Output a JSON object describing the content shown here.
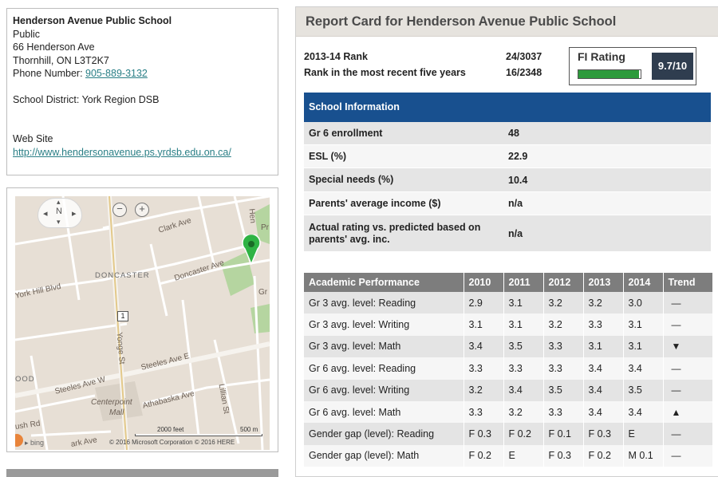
{
  "school": {
    "name": "Henderson Avenue Public School",
    "type": "Public",
    "street": "66 Henderson Ave",
    "city": "Thornhill, ON L3T2K7",
    "phone_label": "Phone Number: ",
    "phone": "905-889-3132",
    "district": "School District: York Region DSB",
    "website_label": "Web Site",
    "website": "http://www.hendersonavenue.ps.yrdsb.edu.on.ca/"
  },
  "map": {
    "compass_n": "N",
    "zoom_out": "−",
    "zoom_in": "+",
    "labels": {
      "clark": "Clark Ave",
      "doncaster_town": "DONCASTER",
      "doncaster_ave": "Doncaster Ave",
      "york_hill": "York Hill Blvd",
      "yonge": "Yonge St",
      "steeles_e": "Steeles Ave E",
      "steeles_w": "Steeles Ave W",
      "centerpoint": "Centerpoint",
      "mall": "Mall",
      "athabaska": "Athabaska Ave",
      "lillian": "Lillian St",
      "ood": "OOD",
      "ush_rd": "ush Rd",
      "ark_ave": "ark Ave",
      "gr": "Gr",
      "pr": "Pr",
      "hend": "Hen",
      "route": "1"
    },
    "scale_feet": "2000 feet",
    "scale_m": "500 m",
    "bing": "bing",
    "copyright": "© 2016 Microsoft Corporation  © 2016 HERE",
    "pin_color": "#2fb344"
  },
  "report": {
    "title": "Report Card for Henderson Avenue Public School",
    "rank_label": "2013-14 Rank",
    "rank_value": "24/3037",
    "rank5_label": "Rank in the most recent five years",
    "rank5_value": "16/2348",
    "fi_label": "FI Rating",
    "fi_score": "9.7/10",
    "fi_fraction": 0.97,
    "bar_color": "#2e9a3c"
  },
  "school_info": {
    "header": "School Information",
    "rows": [
      {
        "label": "Gr 6 enrollment",
        "value": "48"
      },
      {
        "label": "ESL (%)",
        "value": "22.9"
      },
      {
        "label": "Special needs (%)",
        "value": "10.4"
      },
      {
        "label": "Parents' average income ($)",
        "value": "n/a"
      },
      {
        "label": "Actual rating vs. predicted based on parents' avg. inc.",
        "value": "n/a"
      }
    ]
  },
  "academic": {
    "headers": [
      "Academic Performance",
      "2010",
      "2011",
      "2012",
      "2013",
      "2014",
      "Trend"
    ],
    "rows": [
      [
        "Gr 3 avg. level: Reading",
        "2.9",
        "3.1",
        "3.2",
        "3.2",
        "3.0",
        "—"
      ],
      [
        "Gr 3 avg. level: Writing",
        "3.1",
        "3.1",
        "3.2",
        "3.3",
        "3.1",
        "—"
      ],
      [
        "Gr 3 avg. level: Math",
        "3.4",
        "3.5",
        "3.3",
        "3.1",
        "3.1",
        "▼"
      ],
      [
        "Gr 6 avg. level: Reading",
        "3.3",
        "3.3",
        "3.3",
        "3.4",
        "3.4",
        "—"
      ],
      [
        "Gr 6 avg. level: Writing",
        "3.2",
        "3.4",
        "3.5",
        "3.4",
        "3.5",
        "—"
      ],
      [
        "Gr 6 avg. level: Math",
        "3.3",
        "3.2",
        "3.3",
        "3.4",
        "3.4",
        "▲"
      ],
      [
        "Gender gap (level): Reading",
        "F 0.3",
        "F 0.2",
        "F 0.1",
        "F 0.3",
        "E",
        "—"
      ],
      [
        "Gender gap (level): Math",
        "F 0.2",
        "E",
        "F 0.3",
        "F 0.2",
        "M 0.1",
        "—"
      ]
    ]
  }
}
